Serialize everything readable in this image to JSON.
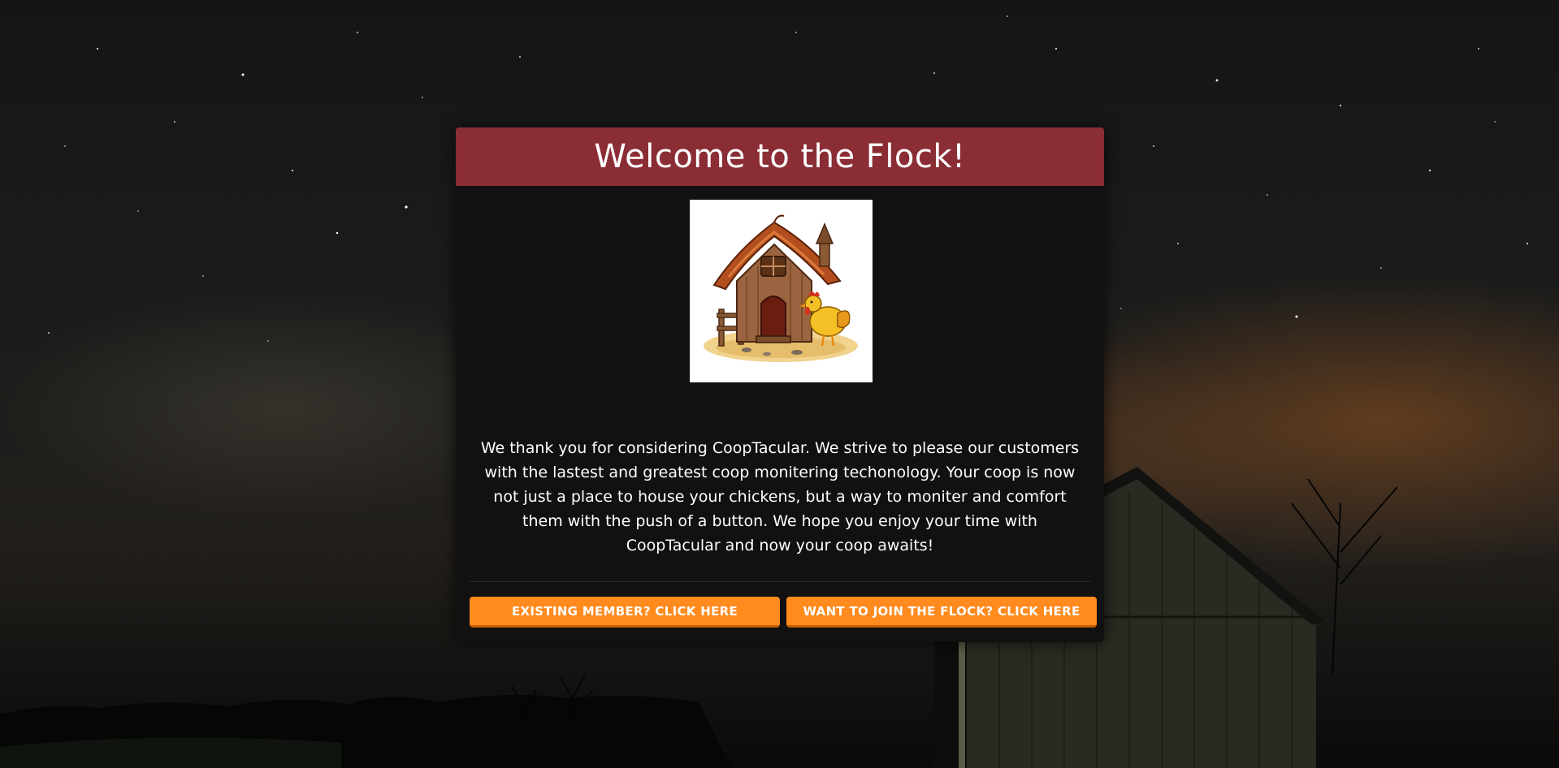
{
  "modal": {
    "title": "Welcome to the Flock!",
    "logo": "chicken-coop-logo",
    "intro_text": "We thank you for considering CoopTacular. We strive to please our customers with the lastest and greatest coop monitering techonology. Your coop is now not just a place to house your chickens, but a way to moniter and comfort them with the push of a button. We hope you enjoy your time with CoopTacular and now your coop awaits!",
    "buttons": {
      "existing_member": "EXISTING MEMBER? CLICK HERE",
      "join_flock": "WANT TO JOIN THE FLOCK? CLICK HERE"
    }
  },
  "colors": {
    "header_bg": "#8b2d35",
    "modal_bg": "#111111",
    "button_bg": "#ff8a1e"
  }
}
